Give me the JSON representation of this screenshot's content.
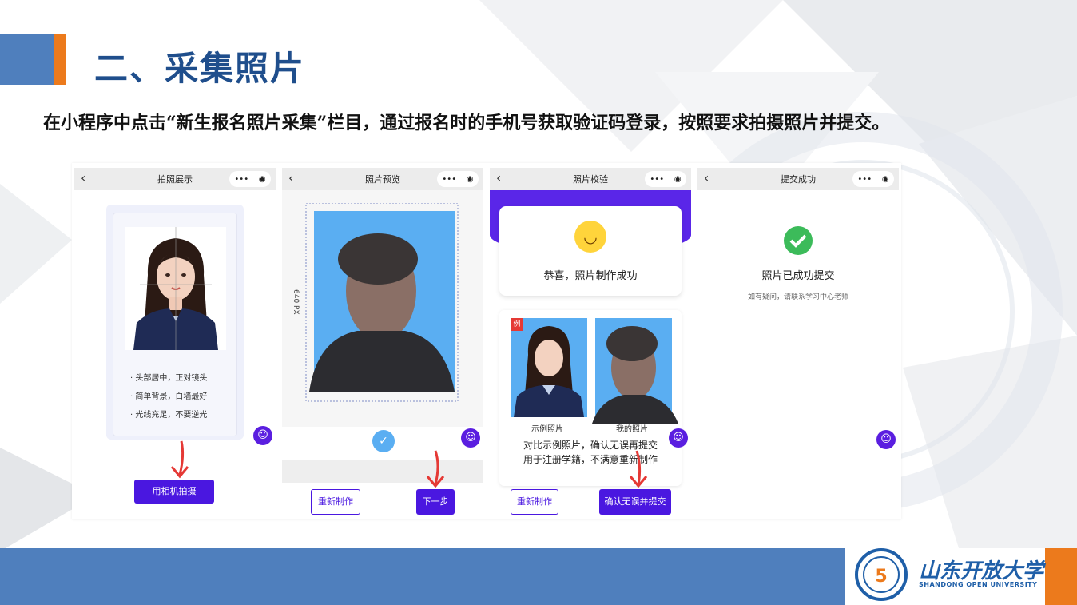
{
  "slide": {
    "title": "二、采集照片",
    "instruction": "在小程序中点击“新生报名照片采集”栏目，通过报名时的手机号获取验证码登录，按照要求拍摄照片并提交。"
  },
  "phones": [
    {
      "nav_title": "拍照展示",
      "back": "‹",
      "menu": "•••",
      "close": "◉",
      "tips": [
        "· 头部居中，正对镜头",
        "· 简单背景，白墙最好",
        "· 光线充足，不要逆光"
      ],
      "button": "用相机拍摄"
    },
    {
      "nav_title": "照片预览",
      "back": "‹",
      "menu": "•••",
      "close": "◉",
      "dimension_label": "640 PX",
      "check": "✓",
      "buttons": [
        "重新制作",
        "下一步"
      ]
    },
    {
      "nav_title": "照片校验",
      "back": "‹",
      "menu": "•••",
      "close": "◉",
      "success_text": "恭喜，照片制作成功",
      "example_tag": "例",
      "example_caption": "示例照片",
      "mine_caption": "我的照片",
      "compare_text_1": "对比示例照片，确认无误再提交",
      "compare_text_2": "用于注册学籍，不满意重新制作",
      "buttons": [
        "重新制作",
        "确认无误并提交"
      ]
    },
    {
      "nav_title": "提交成功",
      "back": "‹",
      "menu": "•••",
      "close": "◉",
      "success_title": "照片已成功提交",
      "success_sub": "如有疑问，请联系学习中心老师"
    }
  ],
  "robot_icon": "☺",
  "footer": {
    "logo_name": "山东开放大学",
    "logo_sub": "SHANDONG OPEN UNIVERSITY"
  },
  "colors": {
    "accent": "#4a17e0",
    "title_blue": "#1f4e8c",
    "bar_blue": "#4f7fbd",
    "bar_orange": "#ec7a1c",
    "success_green": "#3cbb5a"
  }
}
